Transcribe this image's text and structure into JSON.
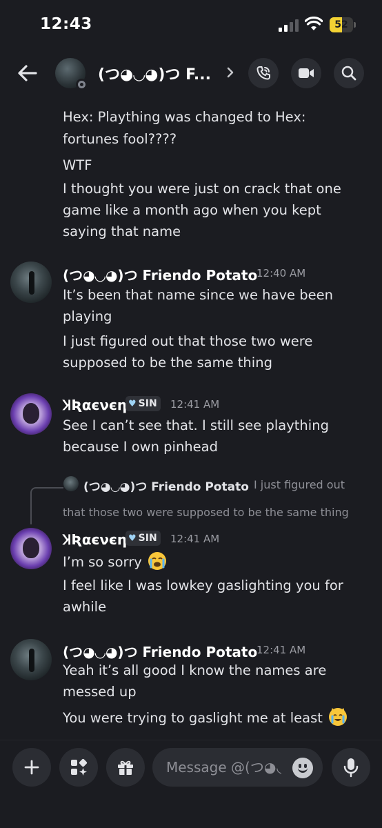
{
  "status_bar": {
    "time": "12:43",
    "battery": "52"
  },
  "header": {
    "title": "(つ◕◡◕)つ F..."
  },
  "messages": {
    "continuation": [
      "Hex: Plaything was changed to Hex:",
      "fortunes fool????",
      "WTF",
      "I thought you were just on crack that one",
      "game like a month ago when you kept",
      "saying that name"
    ],
    "msg1": {
      "username": "(つ◕◡◕)つ Friendo Potato",
      "time": "12:40 AM",
      "lines": [
        "It’s been that name since we have been",
        "playing",
        "I just figured out that those two were",
        "supposed to be the same thing"
      ]
    },
    "msg2": {
      "username": "ꞰƦαєνєη",
      "tag": "SIN",
      "time": "12:41 AM",
      "lines": [
        "See I can’t see that. I still see plaything",
        "because I own pinhead"
      ]
    },
    "reply": {
      "username": "(つ◕◡◕)つ Friendo Potato",
      "text_1": "I just figured out",
      "text_2": "that those two were supposed to be the same thing"
    },
    "msg3": {
      "username": "ꞰƦαєνєη",
      "tag": "SIN",
      "time": "12:41 AM",
      "lines": [
        "I’m so sorry",
        "I feel like I was lowkey gaslighting you for",
        "awhile"
      ]
    },
    "msg4": {
      "username": "(つ◕◡◕)つ Friendo Potato",
      "time": "12:41 AM",
      "lines": [
        "Yeah it’s all good I know the names are",
        "messed up",
        "You were trying to gaslight me at least"
      ]
    }
  },
  "composer": {
    "placeholder": "Message @(つ◕◡"
  },
  "colors": {
    "background": "#1b1c21",
    "button": "#2b2d33",
    "text": "#e3e4e8",
    "muted": "#9b9ca3",
    "battery": "#f3d233"
  }
}
